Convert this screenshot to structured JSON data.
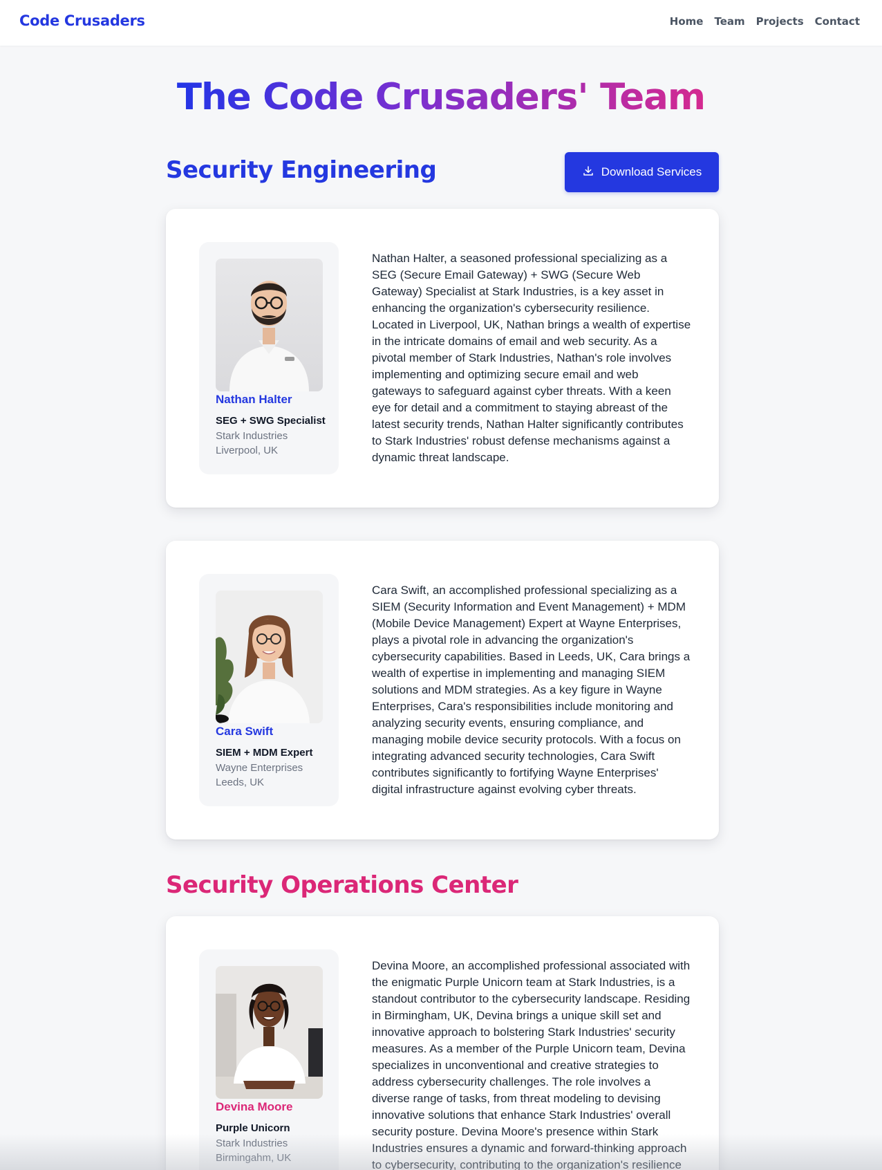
{
  "nav": {
    "brand": "Code Crusaders",
    "links": [
      "Home",
      "Team",
      "Projects",
      "Contact"
    ]
  },
  "hero": {
    "title": "The Code Crusaders' Team"
  },
  "sections": {
    "engineering": {
      "title": "Security Engineering",
      "download_label": "Download Services",
      "download_icon": "download-icon"
    },
    "soc": {
      "title": "Security Operations Center"
    }
  },
  "members": [
    {
      "name": "Nathan Halter",
      "role": "SEG + SWG Specialist",
      "company": "Stark Industries",
      "location": "Liverpool, UK",
      "bio": "Nathan Halter, a seasoned professional specializing as a SEG (Secure Email Gateway) + SWG (Secure Web Gateway) Specialist at Stark Industries, is a key asset in enhancing the organization's cybersecurity resilience. Located in Liverpool, UK, Nathan brings a wealth of expertise in the intricate domains of email and web security. As a pivotal member of Stark Industries, Nathan's role involves implementing and optimizing secure email and web gateways to safeguard against cyber threats. With a keen eye for detail and a commitment to staying abreast of the latest security trends, Nathan Halter significantly contributes to Stark Industries' robust defense mechanisms against a dynamic threat landscape."
    },
    {
      "name": "Cara Swift",
      "role": "SIEM + MDM Expert",
      "company": "Wayne Enterprises",
      "location": "Leeds, UK",
      "bio": "Cara Swift, an accomplished professional specializing as a SIEM (Security Information and Event Management) + MDM (Mobile Device Management) Expert at Wayne Enterprises, plays a pivotal role in advancing the organization's cybersecurity capabilities. Based in Leeds, UK, Cara brings a wealth of expertise in implementing and managing SIEM solutions and MDM strategies. As a key figure in Wayne Enterprises, Cara's responsibilities include monitoring and analyzing security events, ensuring compliance, and managing mobile device security protocols. With a focus on integrating advanced security technologies, Cara Swift contributes significantly to fortifying Wayne Enterprises' digital infrastructure against evolving cyber threats."
    },
    {
      "name": "Devina Moore",
      "role": "Purple Unicorn",
      "company": "Stark Industries",
      "location": "Birmingahm, UK",
      "bio": "Devina Moore, an accomplished professional associated with the enigmatic Purple Unicorn team at Stark Industries, is a standout contributor to the cybersecurity landscape. Residing in Birmingham, UK, Devina brings a unique skill set and innovative approach to bolstering Stark Industries' security measures. As a member of the Purple Unicorn team, Devina specializes in unconventional and creative strategies to address cybersecurity challenges. The role involves a diverse range of tasks, from threat modeling to devising innovative solutions that enhance Stark Industries' overall security posture. Devina Moore's presence within Stark Industries ensures a dynamic and forward-thinking approach to cybersecurity, contributing to the organization's resilience in the face of evolving digital threats."
    }
  ],
  "colors": {
    "brand_blue": "#2438e0",
    "soc_pink": "#db2777",
    "gradient": [
      "#2335e6",
      "#7c2fcf",
      "#d42a90"
    ],
    "page_bg": "#f6f7f9"
  }
}
